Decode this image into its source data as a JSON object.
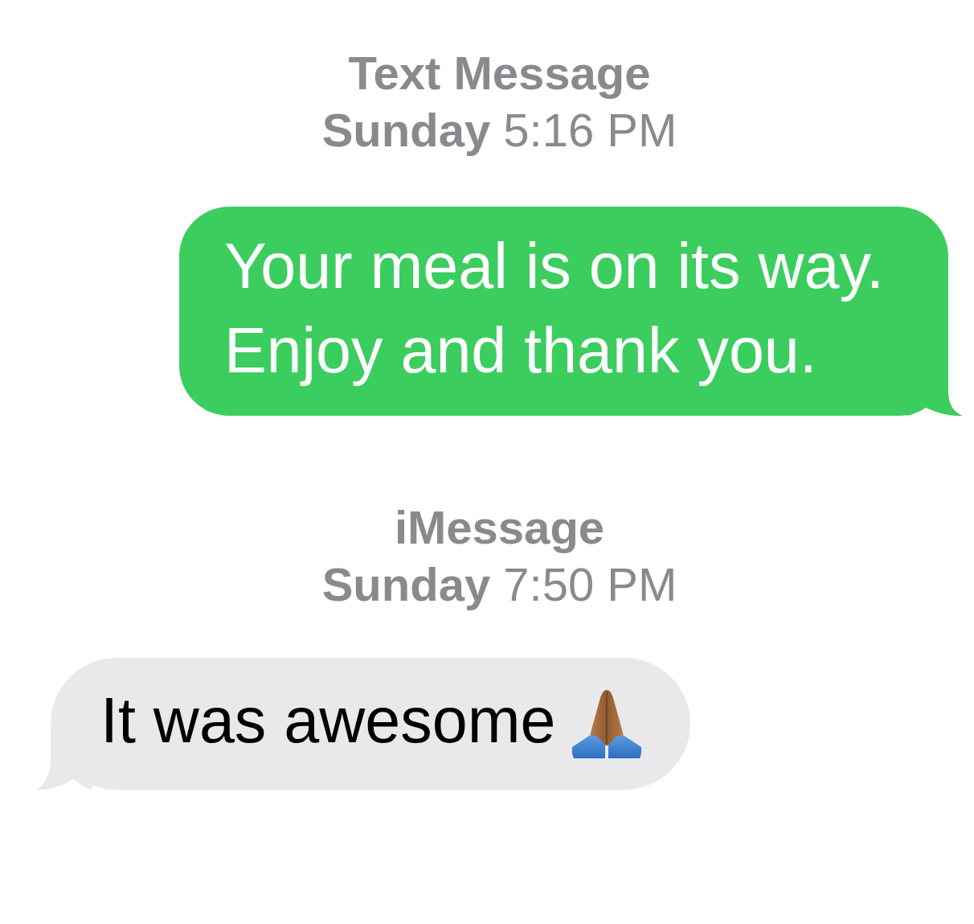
{
  "conversation": [
    {
      "kind": "timestamp",
      "service": "Text Message",
      "when": "**Sunday** 5:16 PM"
    },
    {
      "kind": "outgoing_message",
      "lines": [
        "Your meal is on its way.",
        "Enjoy and thank you."
      ]
    },
    {
      "kind": "timestamp",
      "service": "iMessage",
      "when": "**Sunday** 7:50 PM"
    },
    {
      "kind": "incoming_message",
      "lines": [
        "It was awesome"
      ],
      "has_emoji": true
    }
  ]
}
